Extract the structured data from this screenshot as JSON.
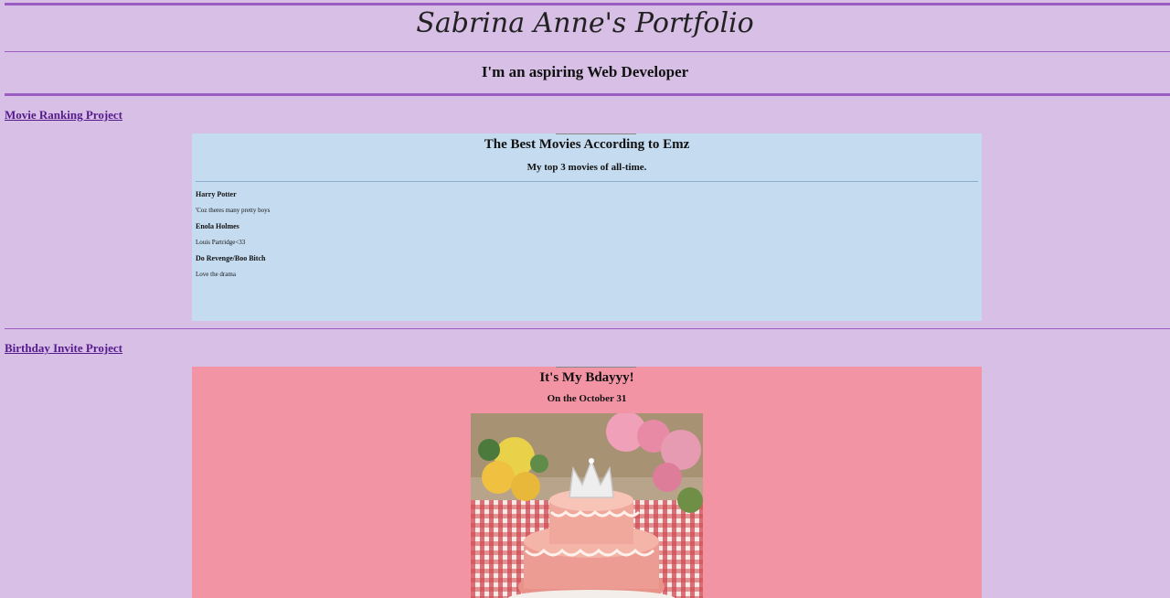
{
  "header": {
    "title": "Sabrina Anne's Portfolio",
    "subtitle": "I'm an aspiring Web Developer"
  },
  "projects": [
    {
      "link": "Movie Ranking Project",
      "heading": "The Best Movies According to Emz",
      "subheading": "My top 3 movies of all-time.",
      "movies": [
        {
          "title": "Harry Potter",
          "desc": "'Coz theres many pretty boys"
        },
        {
          "title": "Enola Holmes",
          "desc": "Louis Partridge<33"
        },
        {
          "title": "Do Revenge/Boo Bitch",
          "desc": "Love the drama"
        }
      ]
    },
    {
      "link": "Birthday Invite Project",
      "heading": "It's My Bdayyy!",
      "subheading": "On the October 31"
    }
  ],
  "colors": {
    "page_bg": "#d7bfe6",
    "rule": "#9b5cc4",
    "movie_bg": "#c5dbf0",
    "bday_bg": "#f394a5",
    "link": "#551a8b"
  }
}
